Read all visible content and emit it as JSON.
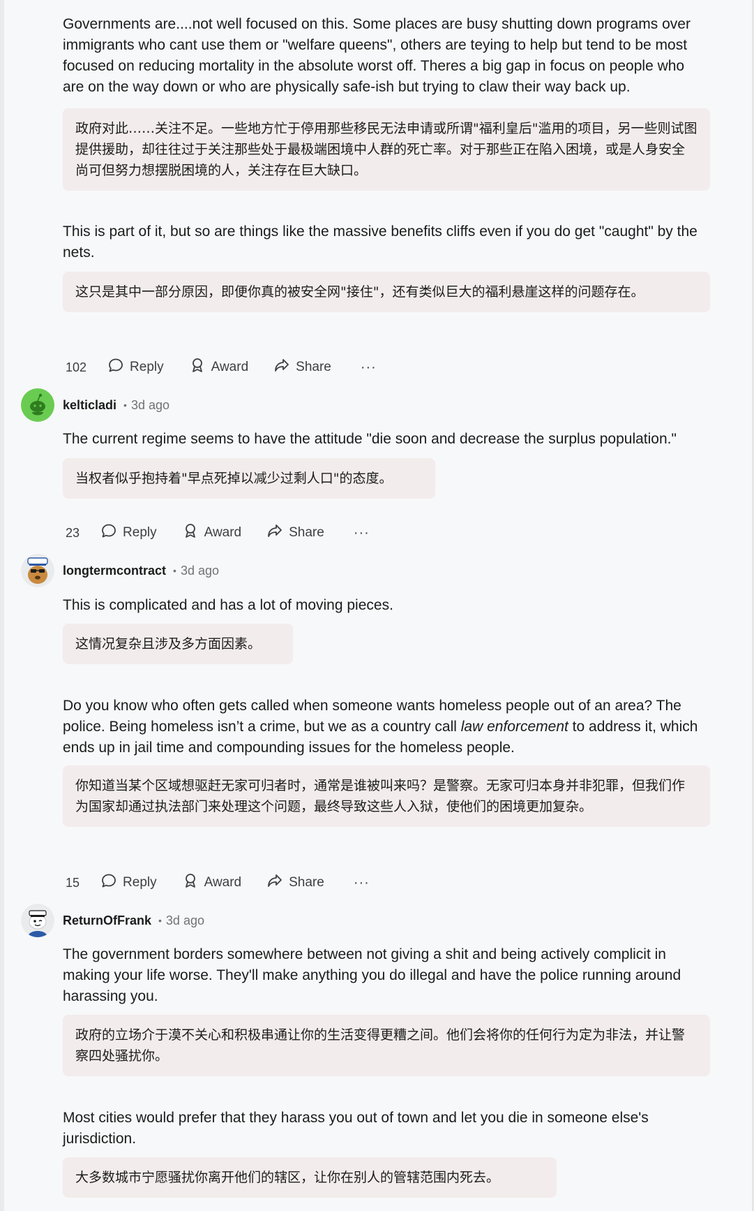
{
  "comments": [
    {
      "paragraphs": [
        {
          "text": "Governments are....not well focused on this. Some places are busy shutting down programs over immigrants who cant use them or \"welfare queens\", others are teying to help but tend to be most focused on reducing mortality in the absolute worst off. Theres a big gap in focus on people who are on the way down or who are physically safe-ish but trying to claw their way back up.",
          "translation": "政府对此……关注不足。一些地方忙于停用那些移民无法申请或所谓\"福利皇后\"滥用的项目，另一些则试图提供援助，却往往过于关注那些处于最极端困境中人群的死亡率。对于那些正在陷入困境，或是人身安全尚可但努力想摆脱困境的人，关注存在巨大缺口。"
        },
        {
          "text": "This is part of it, but so are things like the massive benefits cliffs even if you do get \"caught\" by the nets.",
          "translation": "这只是其中一部分原因，即便你真的被安全网\"接住\"，还有类似巨大的福利悬崖这样的问题存在。"
        }
      ],
      "votes": "102"
    },
    {
      "username": "kelticladi",
      "time": "3d ago",
      "avatar": "snoo-green",
      "paragraphs": [
        {
          "text": "The current regime seems to have the attitude \"die soon and decrease the surplus population.\"",
          "translation": "当权者似乎抱持着\"早点死掉以减少过剩人口\"的态度。"
        }
      ],
      "votes": "23"
    },
    {
      "username": "longtermcontract",
      "time": "3d ago",
      "avatar": "snoo-dog-sailor-cap",
      "paragraphs": [
        {
          "text": "This is complicated and has a lot of moving pieces.",
          "translation": "这情况复杂且涉及多方面因素。"
        },
        {
          "text_before": "Do you know who often gets called when someone wants homeless people out of an area? The police. Being homeless isn’t a crime, but we as a country call ",
          "text_em": "law enforcement",
          "text_after": " to address it, which ends up in jail time and compounding issues for the homeless people.",
          "translation": "你知道当某个区域想驱赶无家可归者时，通常是谁被叫来吗？是警察。无家可归本身并非犯罪，但我们作为国家却通过执法部门来处理这个问题，最终导致这些人入狱，使他们的困境更加复杂。"
        }
      ],
      "votes": "15"
    },
    {
      "username": "ReturnOfFrank",
      "time": "3d ago",
      "avatar": "snoo-sailor-blue",
      "paragraphs": [
        {
          "text": "The government borders somewhere between not giving a shit and being actively complicit in making your life worse. They'll make anything you do illegal and have the police running around harassing you.",
          "translation": "政府的立场介于漠不关心和积极串通让你的生活变得更糟之间。他们会将你的任何行为定为非法，并让警察四处骚扰你。"
        },
        {
          "text": "Most cities would prefer that they harass you out of town and let you die in someone else's jurisdiction.",
          "translation": "大多数城市宁愿骚扰你离开他们的辖区，让你在别人的管辖范围内死去。"
        }
      ]
    }
  ],
  "actions": {
    "reply": "Reply",
    "award": "Award",
    "share": "Share",
    "more": "···"
  },
  "meta_separator": "•",
  "icons": [
    "upvote-icon",
    "downvote-icon",
    "reply-icon",
    "award-icon",
    "share-icon",
    "more-icon"
  ]
}
